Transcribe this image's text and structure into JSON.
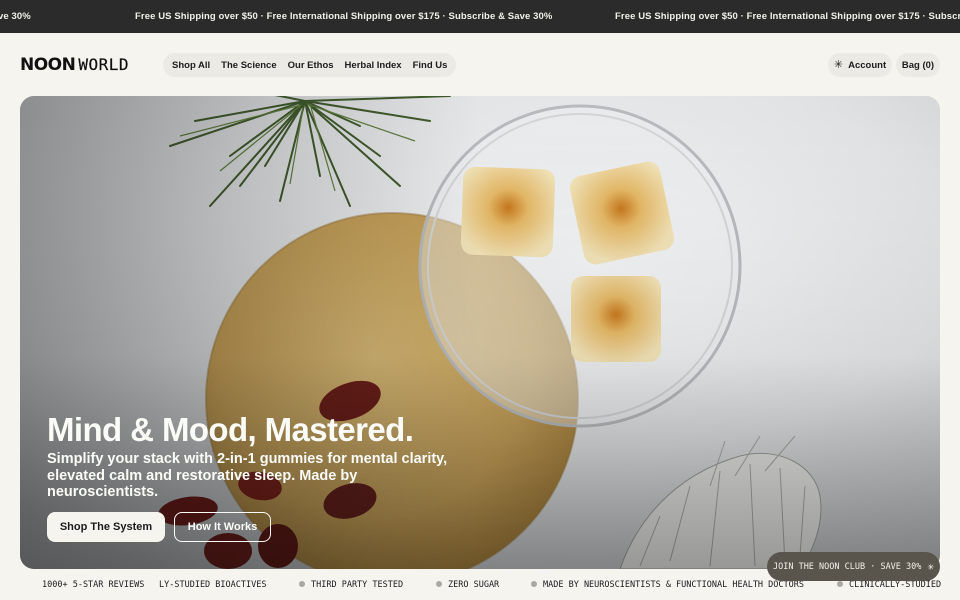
{
  "announcement": {
    "segment_1": "ve 30%",
    "segment_2": "Free US Shipping over $50 · Free International Shipping over $175 · Subscribe & Save 30%",
    "segment_3": "Free US Shipping over $50 · Free International Shipping over $175 · Subscribe & Sa"
  },
  "header": {
    "logo_part_1": "NOON",
    "logo_part_2": "WORLD",
    "nav": [
      "Shop All",
      "The Science",
      "Our Ethos",
      "Herbal Index",
      "Find Us"
    ],
    "account_label": "Account",
    "account_icon": "asterisk-icon",
    "bag_label": "Bag (0)"
  },
  "hero": {
    "title": "Mind & Mood, Mastered.",
    "subtitle": "Simplify your stack with 2-in-1 gummies for mental clarity, elevated calm and restorative sleep. Made by neuroscientists.",
    "primary_cta": "Shop The System",
    "secondary_cta": "How It Works"
  },
  "club_popup": {
    "label": "JOIN THE NOON CLUB · SAVE 30%",
    "icon": "asterisk-icon"
  },
  "ticker": [
    "1000+ 5-STAR REVIEWS",
    "LY-STUDIED BIOACTIVES",
    "THIRD PARTY TESTED",
    "ZERO SUGAR",
    "MADE BY NEUROSCIENTISTS & FUNCTIONAL HEALTH DOCTORS",
    "CLINICALLY-STUDIED"
  ],
  "colors": {
    "announcement_bg": "#2b2b2b",
    "page_bg": "#f5f4ef",
    "nav_pill": "#ebeae4",
    "club_pill": "#5a554c"
  }
}
